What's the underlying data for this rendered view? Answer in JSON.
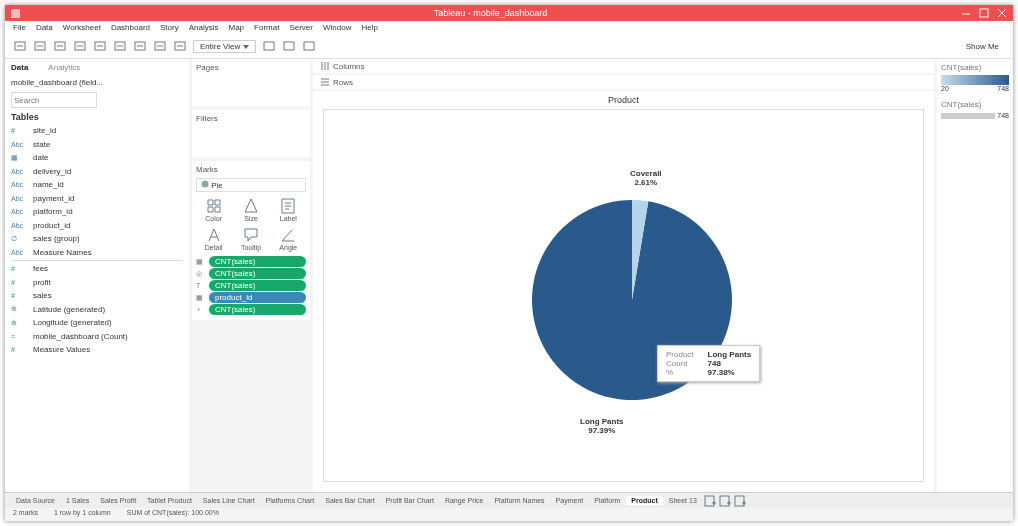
{
  "window": {
    "title": "Tableau - mobile_dashboard"
  },
  "menu": [
    "File",
    "Data",
    "Worksheet",
    "Dashboard",
    "Story",
    "Analysis",
    "Map",
    "Format",
    "Server",
    "Window",
    "Help"
  ],
  "toolbar": {
    "view_select": "Entire View",
    "show_me": "Show Me"
  },
  "data_pane": {
    "tabs": [
      {
        "label": "Data",
        "selected": true
      },
      {
        "label": "Analytics",
        "selected": false
      }
    ],
    "source": "mobile_dashboard (field...",
    "search": {
      "placeholder": "Search"
    },
    "section": "Tables",
    "fields": [
      {
        "icon": "#",
        "name": "site_id",
        "kind": "dimension"
      },
      {
        "icon": "Abc",
        "name": "state",
        "kind": "dimension"
      },
      {
        "icon": "▦",
        "name": "date",
        "kind": "dimension"
      },
      {
        "icon": "Abc",
        "name": "delivery_id",
        "kind": "dimension"
      },
      {
        "icon": "Abc",
        "name": "name_id",
        "kind": "dimension"
      },
      {
        "icon": "Abc",
        "name": "payment_id",
        "kind": "dimension"
      },
      {
        "icon": "Abc",
        "name": "platform_id",
        "kind": "dimension"
      },
      {
        "icon": "Abc",
        "name": "product_id",
        "kind": "dimension"
      },
      {
        "icon": "∅",
        "name": "sales (group)",
        "kind": "dimension"
      },
      {
        "icon": "Abc",
        "name": "Measure Names",
        "kind": "dimension"
      },
      {
        "icon": "#",
        "name": "fees",
        "kind": "measure"
      },
      {
        "icon": "#",
        "name": "profit",
        "kind": "measure"
      },
      {
        "icon": "#",
        "name": "sales",
        "kind": "measure"
      },
      {
        "icon": "⊕",
        "name": "Latitude (generated)",
        "kind": "measure"
      },
      {
        "icon": "⊕",
        "name": "Longitude (generated)",
        "kind": "measure"
      },
      {
        "icon": "=",
        "name": "mobile_dashboard (Count)",
        "kind": "measure"
      },
      {
        "icon": "#",
        "name": "Measure Values",
        "kind": "measure"
      }
    ]
  },
  "cards": {
    "pages": "Pages",
    "filters": "Filters",
    "marks": "Marks",
    "mark_type": "Pie",
    "mark_buttons": [
      "Color",
      "Size",
      "Label",
      "Detail",
      "Tooltip",
      "Angle"
    ],
    "pills": [
      {
        "icon": "▦",
        "label": "CNT(sales)",
        "kind": "measure"
      },
      {
        "icon": "◎",
        "label": "CNT(sales)",
        "kind": "measure"
      },
      {
        "icon": "T",
        "label": "CNT(sales)",
        "kind": "measure"
      },
      {
        "icon": "▦",
        "label": "product_id",
        "kind": "dimension"
      },
      {
        "icon": "◔",
        "label": "CNT(sales)",
        "kind": "measure"
      }
    ]
  },
  "shelves": {
    "columns": "Columns",
    "rows": "Rows"
  },
  "view": {
    "title": "Product",
    "chart_data": {
      "type": "pie",
      "categories": [
        "Long Pants",
        "Coverall"
      ],
      "values": [
        97.39,
        2.61
      ],
      "value_labels": [
        "97.39%",
        "2.61%"
      ]
    },
    "tooltip": [
      {
        "key": "Product",
        "value": "Long Pants"
      },
      {
        "key": "Count",
        "value": "748"
      },
      {
        "key": "%",
        "value": "97.38%"
      }
    ]
  },
  "legends": [
    {
      "title": "CNT(sales)",
      "kind": "gradient",
      "min": "20",
      "max": "748"
    },
    {
      "title": "CNT(sales)",
      "kind": "size",
      "max": "748"
    }
  ],
  "sheet_tabs": [
    {
      "label": "Data Source",
      "selected": false
    },
    {
      "label": "1 Sales",
      "selected": false
    },
    {
      "label": "Sales Profit",
      "selected": false
    },
    {
      "label": "Tablet Product",
      "selected": false
    },
    {
      "label": "Sales Line Chart",
      "selected": false
    },
    {
      "label": "Platforms Chart",
      "selected": false
    },
    {
      "label": "Sales Bar Chart",
      "selected": false
    },
    {
      "label": "Profit Bar Chart",
      "selected": false
    },
    {
      "label": "Range Price",
      "selected": false
    },
    {
      "label": "Platform Names",
      "selected": false
    },
    {
      "label": "Payment",
      "selected": false
    },
    {
      "label": "Platform",
      "selected": false
    },
    {
      "label": "Product",
      "selected": true
    },
    {
      "label": "Sheet 13",
      "selected": false
    }
  ],
  "status_bar": [
    "2 marks",
    "1 row by 1 column",
    "SUM of CNT(sales): 100.00%"
  ]
}
